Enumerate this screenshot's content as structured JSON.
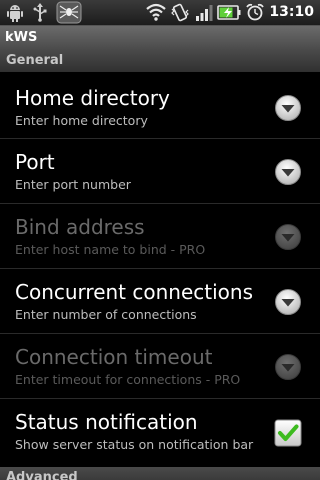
{
  "status_bar": {
    "clock": "13:10",
    "icons": [
      "android-debug-icon",
      "usb-icon",
      "spider-app-icon",
      "wifi-icon",
      "vibrate-icon",
      "signal-icon",
      "battery-charging-icon",
      "alarm-clock-icon"
    ]
  },
  "app": {
    "title": "kWS"
  },
  "categories": {
    "general": "General",
    "advanced": "Advanced"
  },
  "preferences": [
    {
      "title": "Home directory",
      "summary": "Enter home directory",
      "enabled": true,
      "widget": "dropdown"
    },
    {
      "title": "Port",
      "summary": "Enter port number",
      "enabled": true,
      "widget": "dropdown"
    },
    {
      "title": "Bind address",
      "summary": "Enter host name to bind - PRO",
      "enabled": false,
      "widget": "dropdown"
    },
    {
      "title": "Concurrent connections",
      "summary": "Enter number of connections",
      "enabled": true,
      "widget": "dropdown"
    },
    {
      "title": "Connection timeout",
      "summary": "Enter timeout for connections - PRO",
      "enabled": false,
      "widget": "dropdown"
    },
    {
      "title": "Status notification",
      "summary": "Show server status on notification bar",
      "enabled": true,
      "widget": "checkbox",
      "checked": true
    }
  ],
  "colors": {
    "background": "#000000",
    "title_enabled": "#ffffff",
    "title_disabled": "#6a6a6a",
    "checkmark": "#3dbb1f"
  }
}
